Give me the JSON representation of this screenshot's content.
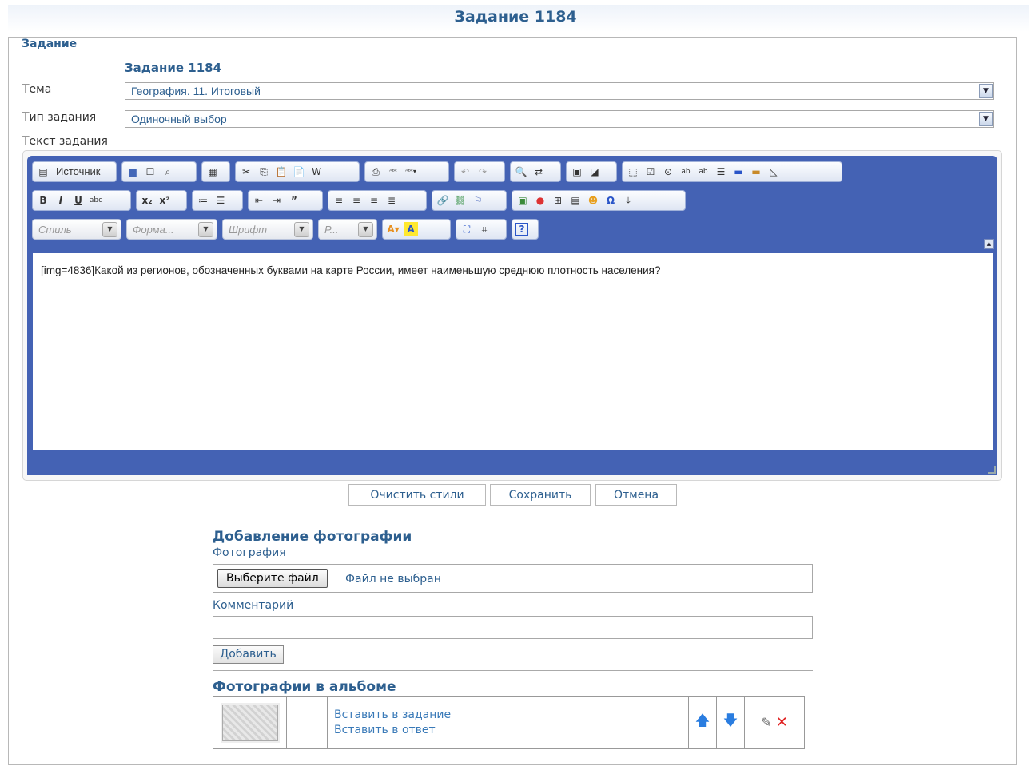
{
  "page": {
    "title": "Задание 1184"
  },
  "task": {
    "legend": "Задание",
    "subtitle": "Задание 1184",
    "topic_label": "Тема",
    "topic_value": "География. 11. Итоговый",
    "type_label": "Тип задания",
    "type_value": "Одиночный выбор",
    "text_label": "Текст задания"
  },
  "toolbar": {
    "source_label": "Источник",
    "style_placeholder": "Стиль",
    "format_placeholder": "Форма...",
    "font_placeholder": "Шрифт",
    "size_placeholder": "Р..."
  },
  "editor": {
    "content": "[img=4836]Какой из регионов, обозначенных буквами на карте России, имеет наименьшую среднюю плотность населения?"
  },
  "actions": {
    "clear_styles": "Очистить стили",
    "save": "Сохранить",
    "cancel": "Отмена"
  },
  "photo_form": {
    "title": "Добавление фотографии",
    "photo_label": "Фотография",
    "choose_file": "Выберите файл",
    "no_file": "Файл не выбран",
    "comment_label": "Комментарий",
    "add_button": "Добавить"
  },
  "album": {
    "title": "Фотографии в альбоме",
    "insert_task": "Вставить в задание",
    "insert_answer": "Вставить в ответ"
  },
  "colors": {
    "accent": "#2d5f8f",
    "editor_bg": "#4462b4",
    "link": "#3a7ab8"
  }
}
